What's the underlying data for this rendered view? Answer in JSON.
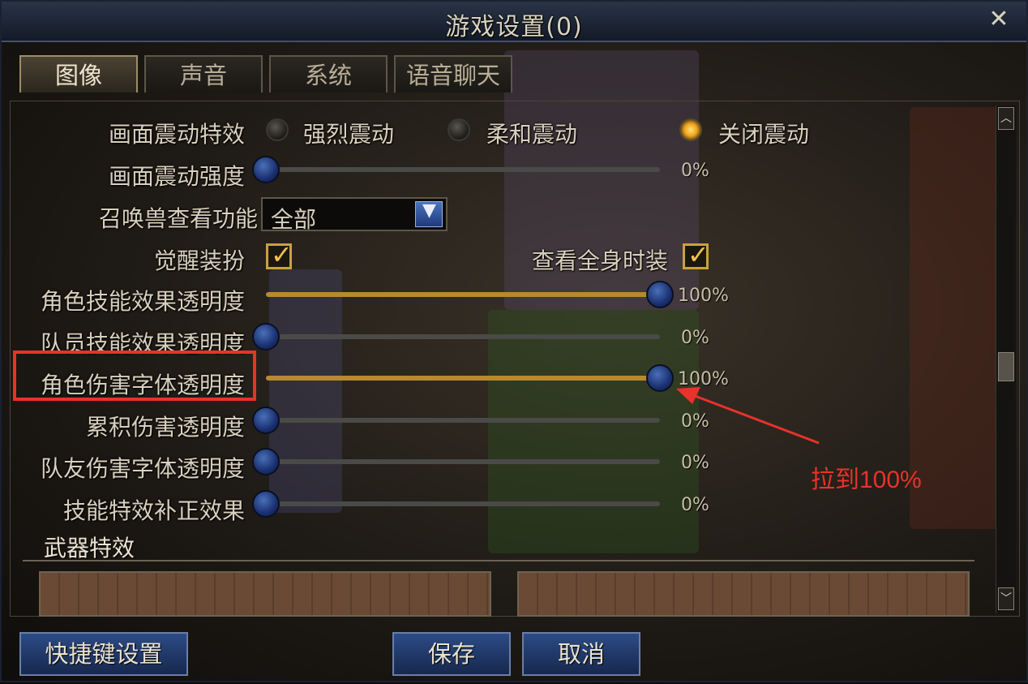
{
  "window": {
    "title": "游戏设置(0)",
    "close_glyph": "✕"
  },
  "tabs": [
    {
      "label": "图像",
      "active": true
    },
    {
      "label": "声音",
      "active": false
    },
    {
      "label": "系统",
      "active": false
    },
    {
      "label": "语音聊天",
      "active": false
    }
  ],
  "settings": {
    "shake_effect": {
      "label": "画面震动特效",
      "options": [
        "强烈震动",
        "柔和震动",
        "关闭震动"
      ],
      "selected": "关闭震动"
    },
    "shake_strength": {
      "label": "画面震动强度",
      "value": 0,
      "text": "0%"
    },
    "summon_view": {
      "label": "召唤兽查看功能",
      "value": "全部"
    },
    "awaken_outfit": {
      "label": "觉醒装扮",
      "checked": true
    },
    "full_fashion": {
      "label": "查看全身时装",
      "checked": true
    },
    "sliders": [
      {
        "label": "角色技能效果透明度",
        "value": 100,
        "text": "100%"
      },
      {
        "label": "队员技能效果透明度",
        "value": 0,
        "text": "0%"
      },
      {
        "label": "角色伤害字体透明度",
        "value": 100,
        "text": "100%"
      },
      {
        "label": "累积伤害透明度",
        "value": 0,
        "text": "0%"
      },
      {
        "label": "队友伤害字体透明度",
        "value": 0,
        "text": "0%"
      },
      {
        "label": "技能特效补正效果",
        "value": 0,
        "text": "0%"
      }
    ]
  },
  "weapon_section": {
    "title": "武器特效"
  },
  "buttons": {
    "shortcut": "快捷键设置",
    "save": "保存",
    "cancel": "取消"
  },
  "annotation": {
    "text": "拉到100%",
    "color": "#e8322b"
  },
  "colors": {
    "accent_gold": "#b8892e",
    "knob_blue": "#1a3070",
    "highlight_red": "#e8322b"
  }
}
